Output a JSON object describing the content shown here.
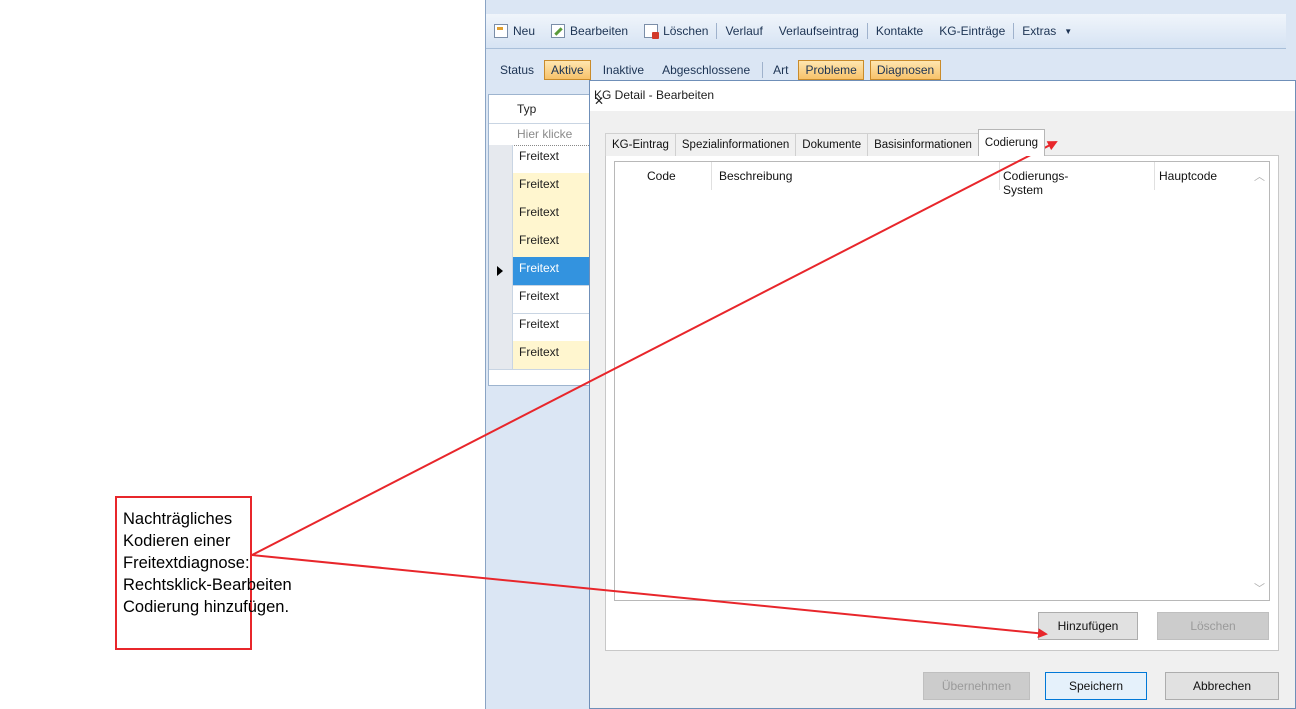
{
  "toolbar": {
    "items": [
      "Neu",
      "Bearbeiten",
      "Löschen",
      "Verlauf",
      "Verlaufseintrag",
      "Kontakte",
      "KG-Einträge",
      "Extras"
    ]
  },
  "statusbar": {
    "status_label": "Status",
    "aktive": "Aktive",
    "inaktive": "Inaktive",
    "abgeschlossene": "Abgeschlossene",
    "art_label": "Art",
    "probleme": "Probleme",
    "diagnosen": "Diagnosen"
  },
  "grid": {
    "header": "Typ",
    "filter_placeholder": "Hier klicke",
    "rows": [
      "Freitext",
      "Freitext",
      "Freitext",
      "Freitext",
      "Freitext",
      "Freitext",
      "Freitext",
      "Freitext"
    ]
  },
  "dialog": {
    "title": "KG Detail - Bearbeiten",
    "close_glyph": "✕",
    "tabs": [
      "KG-Eintrag",
      "Spezialinformationen",
      "Dokumente",
      "Basisinformationen",
      "Codierung"
    ],
    "active_tab": "Codierung",
    "table": {
      "columns": [
        "Code",
        "Beschreibung",
        "Codierungs-System",
        "Hauptcode"
      ]
    },
    "buttons": {
      "add": "Hinzufügen",
      "delete": "Löschen",
      "apply": "Übernehmen",
      "save": "Speichern",
      "cancel": "Abbrechen"
    }
  },
  "annotation": {
    "lines": [
      "Nachträgliches",
      "Kodieren einer",
      "Freitextdiagnose:",
      "Rechtsklick-Bearbeiten",
      "Codierung hinzufügen."
    ],
    "color": "#e8262b"
  },
  "colors": {
    "highlight_orange": "#f7c26a",
    "row_yellow": "#fff6cf",
    "row_selected": "#3393df",
    "primary_border": "#0078d7"
  }
}
